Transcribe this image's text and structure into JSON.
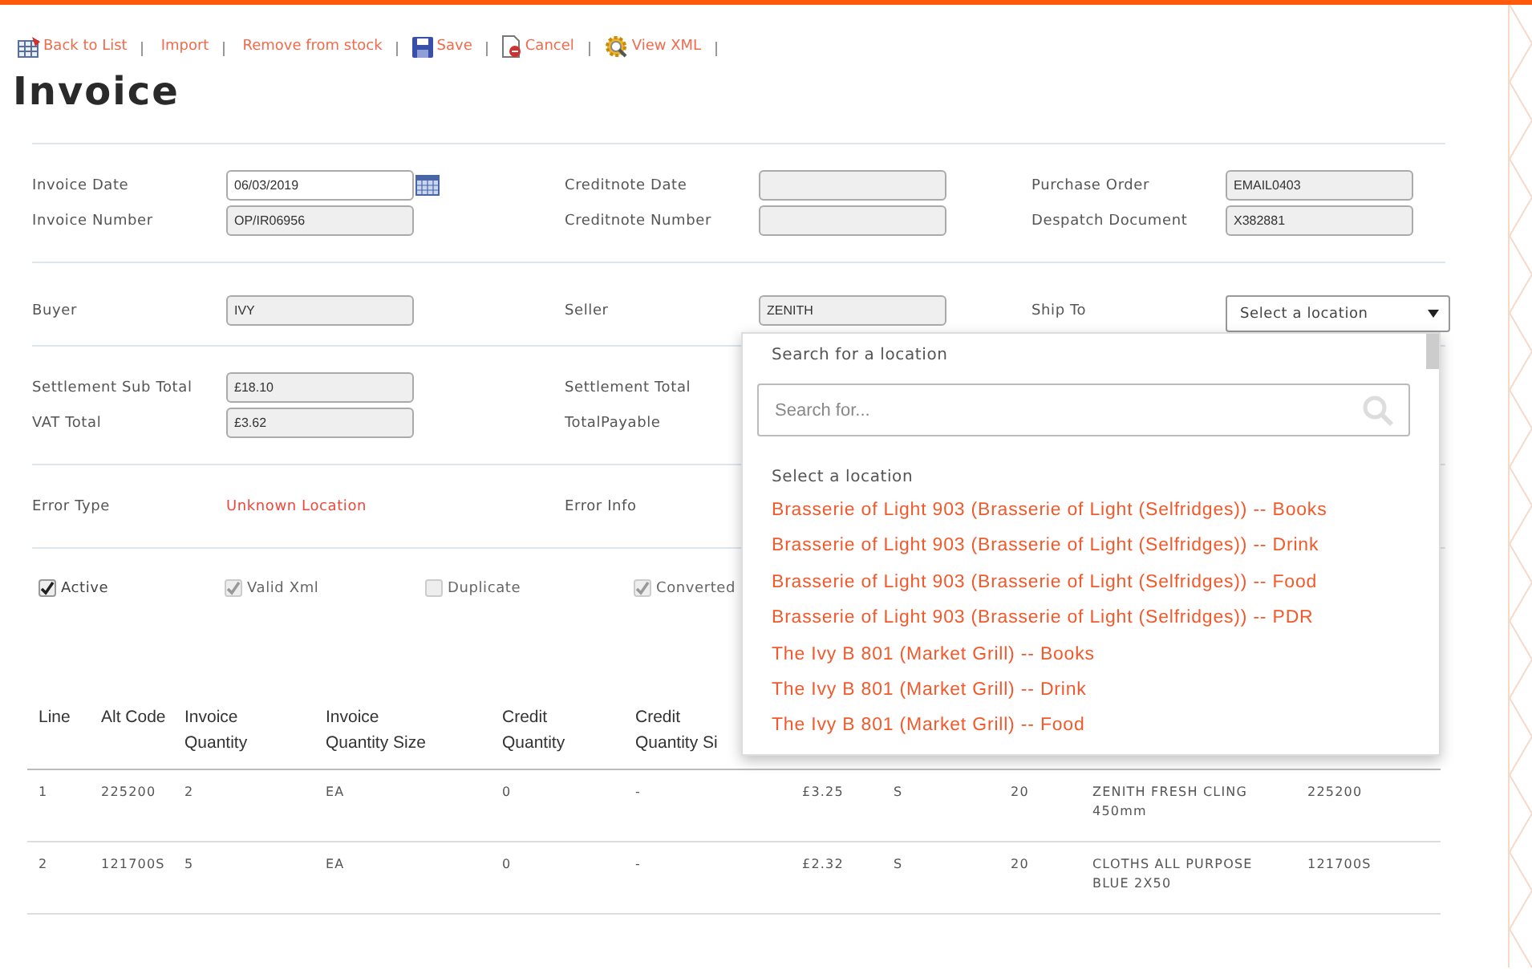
{
  "toolbar": [
    {
      "label": "Back to List",
      "kind": "list"
    },
    {
      "label": "Import",
      "kind": "plain"
    },
    {
      "label": "Remove from stock",
      "kind": "plain"
    },
    {
      "label": "Save",
      "kind": "save"
    },
    {
      "label": "Cancel",
      "kind": "cancel"
    },
    {
      "label": "View XML",
      "kind": "xml"
    }
  ],
  "title": "Invoice",
  "sections": [
    {
      "rows": [
        [
          {
            "label": "Invoice Date",
            "kind": "date",
            "value": "06/03/2019"
          },
          {
            "label": "Creditnote Date",
            "kind": "readonly"
          },
          {
            "label": "Purchase Order",
            "kind": "readonly",
            "value": "EMAIL0403"
          }
        ],
        [
          {
            "label": "Invoice Number",
            "kind": "readonly",
            "value": "OP/IR06956"
          },
          {
            "label": "Creditnote Number",
            "kind": "readonly"
          },
          {
            "label": "Despatch Document",
            "kind": "readonly",
            "value": "X382881"
          }
        ]
      ]
    },
    {
      "rows": [
        [
          {
            "label": "Buyer",
            "kind": "readonly",
            "value": "IVY"
          },
          {
            "label": "Seller",
            "kind": "readonly",
            "value": "ZENITH"
          },
          {
            "label": "Ship To",
            "kind": "select",
            "value": "Select a location",
            "expanded": true
          }
        ]
      ]
    },
    {
      "rows": [
        [
          {
            "label": "Settlement Sub Total",
            "kind": "readonly",
            "value": "£18.10"
          },
          {
            "label": "Settlement Total",
            "kind": "label"
          }
        ],
        [
          {
            "label": "VAT Total",
            "kind": "readonly",
            "value": "£3.62"
          },
          {
            "label": "TotalPayable",
            "kind": "label"
          }
        ]
      ]
    },
    {
      "rows": [
        [
          {
            "label": "Error Type",
            "kind": "error",
            "value": "Unknown Location"
          },
          {
            "label": "Error Info",
            "kind": "label"
          }
        ]
      ]
    }
  ],
  "checkboxes": [
    {
      "label": "Active",
      "checked": true,
      "disabled": false
    },
    {
      "label": "Valid Xml",
      "checked": true,
      "disabled": true
    },
    {
      "label": "Duplicate",
      "checked": false,
      "disabled": true
    },
    {
      "label": "Converted",
      "checked": true,
      "disabled": true
    }
  ],
  "dropdown": {
    "heading": "Search for a location",
    "search_placeholder": "Search for...",
    "group_label": "Select a location",
    "options": [
      "Brasserie of Light 903 (Brasserie of Light (Selfridges)) -- Books",
      "Brasserie of Light 903 (Brasserie of Light (Selfridges)) -- Drink",
      "Brasserie of Light 903 (Brasserie of Light (Selfridges)) -- Food",
      "Brasserie of Light 903 (Brasserie of Light (Selfridges)) -- PDR",
      "The Ivy B 801 (Market Grill) -- Books",
      "The Ivy B 801 (Market Grill) -- Drink",
      "The Ivy B 801 (Market Grill) -- Food"
    ]
  },
  "table": {
    "columns": [
      "Line",
      "Alt Code",
      "Invoice Quantity",
      "Invoice Quantity Size",
      "Credit Quantity",
      "Credit Quantity Si"
    ],
    "rows": [
      [
        "1",
        "225200",
        "2",
        "EA",
        "0",
        "-",
        "£3.25",
        "S",
        "20",
        "ZENITH FRESH CLING 450mm",
        "225200"
      ],
      [
        "2",
        "121700S",
        "5",
        "EA",
        "0",
        "-",
        "£2.32",
        "S",
        "20",
        "CLOTHS ALL PURPOSE BLUE 2X50",
        "121700S"
      ]
    ]
  }
}
